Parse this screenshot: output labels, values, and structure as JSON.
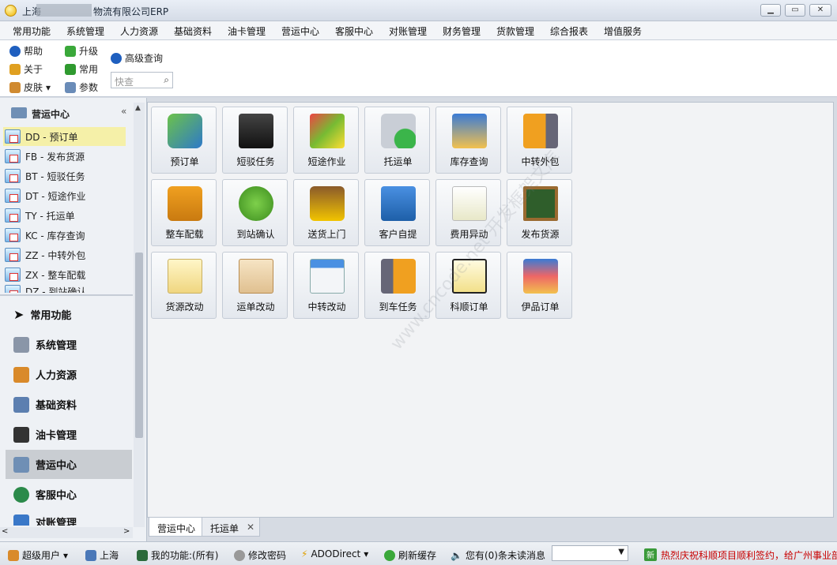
{
  "window": {
    "title_left": "上海",
    "title_right": "物流有限公司ERP"
  },
  "menu": [
    "常用功能",
    "系统管理",
    "人力资源",
    "基础资料",
    "油卡管理",
    "营运中心",
    "客服中心",
    "对账管理",
    "财务管理",
    "货款管理",
    "综合报表",
    "增值服务"
  ],
  "ribbon": {
    "help": "帮助",
    "upgrade": "升级",
    "advanced_search": "高级查询",
    "about": "关于",
    "common": "常用",
    "skin": "皮肤",
    "params": "参数",
    "search_placeholder": "快查"
  },
  "left": {
    "header": "营运中心",
    "tree": [
      "DD - 预订单",
      "FB - 发布货源",
      "BT - 短驳任务",
      "DT - 短途作业",
      "TY - 托运单",
      "KC - 库存查询",
      "ZZ - 中转外包",
      "ZX - 整车配载",
      "DZ - 到站确认"
    ],
    "nav": [
      "常用功能",
      "系统管理",
      "人力资源",
      "基础资料",
      "油卡管理",
      "营运中心",
      "客服中心",
      "对账管理"
    ]
  },
  "tiles": [
    [
      "预订单",
      "短驳任务",
      "短途作业",
      "托运单",
      "库存查询",
      "中转外包"
    ],
    [
      "整车配载",
      "到站确认",
      "送货上门",
      "客户自提",
      "费用异动",
      "发布货源"
    ],
    [
      "货源改动",
      "运单改动",
      "中转改动",
      "到车任务",
      "科顺订单",
      "伊品订单"
    ]
  ],
  "tabs": [
    "营运中心",
    "托运单"
  ],
  "status": {
    "user": "超级用户",
    "city": "上海",
    "my_func": "我的功能:(所有)",
    "change_pwd": "修改密码",
    "ado": "ADODirect",
    "refresh": "刷新缓存",
    "messages": "您有(0)条未读消息",
    "news": "热烈庆祝科顺项目顺利签约，给广州事业部"
  },
  "watermark": "www.cncode.net 开发框架文库"
}
